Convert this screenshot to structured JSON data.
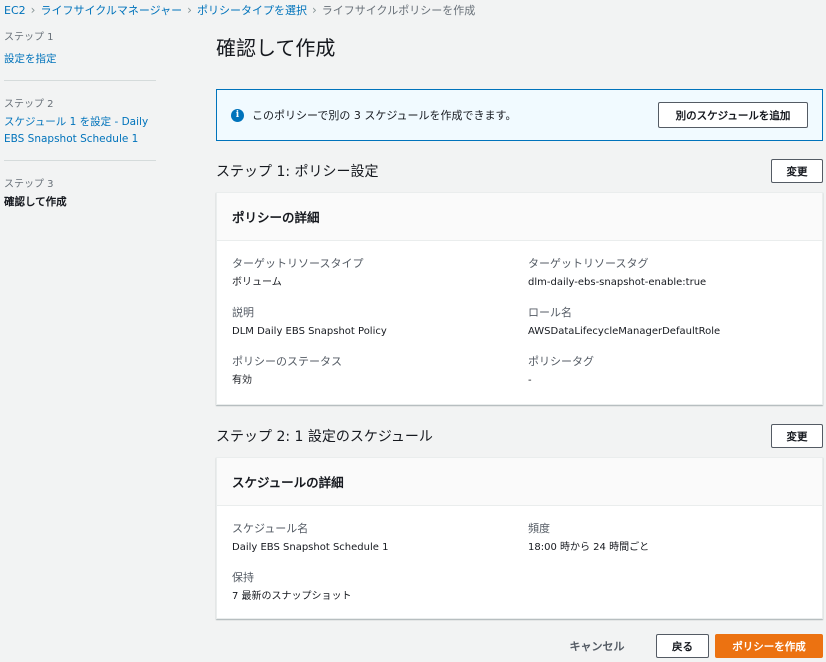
{
  "breadcrumb": [
    {
      "label": "EC2"
    },
    {
      "label": "ライフサイクルマネージャー"
    },
    {
      "label": "ポリシータイプを選択"
    },
    {
      "label": "ライフサイクルポリシーを作成"
    }
  ],
  "steps": [
    {
      "num": "ステップ 1",
      "title": "設定を指定"
    },
    {
      "num": "ステップ 2",
      "title": "スケジュール 1 を設定 - Daily EBS Snapshot Schedule 1"
    },
    {
      "num": "ステップ 3",
      "title": "確認して作成"
    }
  ],
  "page_title": "確認して作成",
  "info": {
    "icon": "info-icon",
    "text": "このポリシーで別の 3 スケジュールを作成できます。",
    "add_button": "別のスケジュールを追加"
  },
  "section1": {
    "title": "ステップ 1: ポリシー設定",
    "edit_button": "変更",
    "card_title": "ポリシーの詳細",
    "fields": [
      {
        "label": "ターゲットリソースタイプ",
        "value": "ボリューム"
      },
      {
        "label": "ターゲットリソースタグ",
        "value": "dlm-daily-ebs-snapshot-enable:true"
      },
      {
        "label": "説明",
        "value": "DLM Daily EBS Snapshot Policy"
      },
      {
        "label": "ロール名",
        "value": "AWSDataLifecycleManagerDefaultRole"
      },
      {
        "label": "ポリシーのステータス",
        "value": "有効"
      },
      {
        "label": "ポリシータグ",
        "value": "-"
      }
    ]
  },
  "section2": {
    "title": "ステップ 2: 1 設定のスケジュール",
    "edit_button": "変更",
    "card_title": "スケジュールの詳細",
    "fields": [
      {
        "label": "スケジュール名",
        "value": "Daily EBS Snapshot Schedule 1"
      },
      {
        "label": "頻度",
        "value": "18:00 時から 24 時間ごと"
      },
      {
        "label": "保持",
        "value": "7 最新のスナップショット"
      }
    ]
  },
  "footer": {
    "cancel": "キャンセル",
    "back": "戻る",
    "create": "ポリシーを作成"
  },
  "colors": {
    "link": "#0073bb",
    "primary": "#ec7211",
    "info_bg": "#f1faff"
  }
}
